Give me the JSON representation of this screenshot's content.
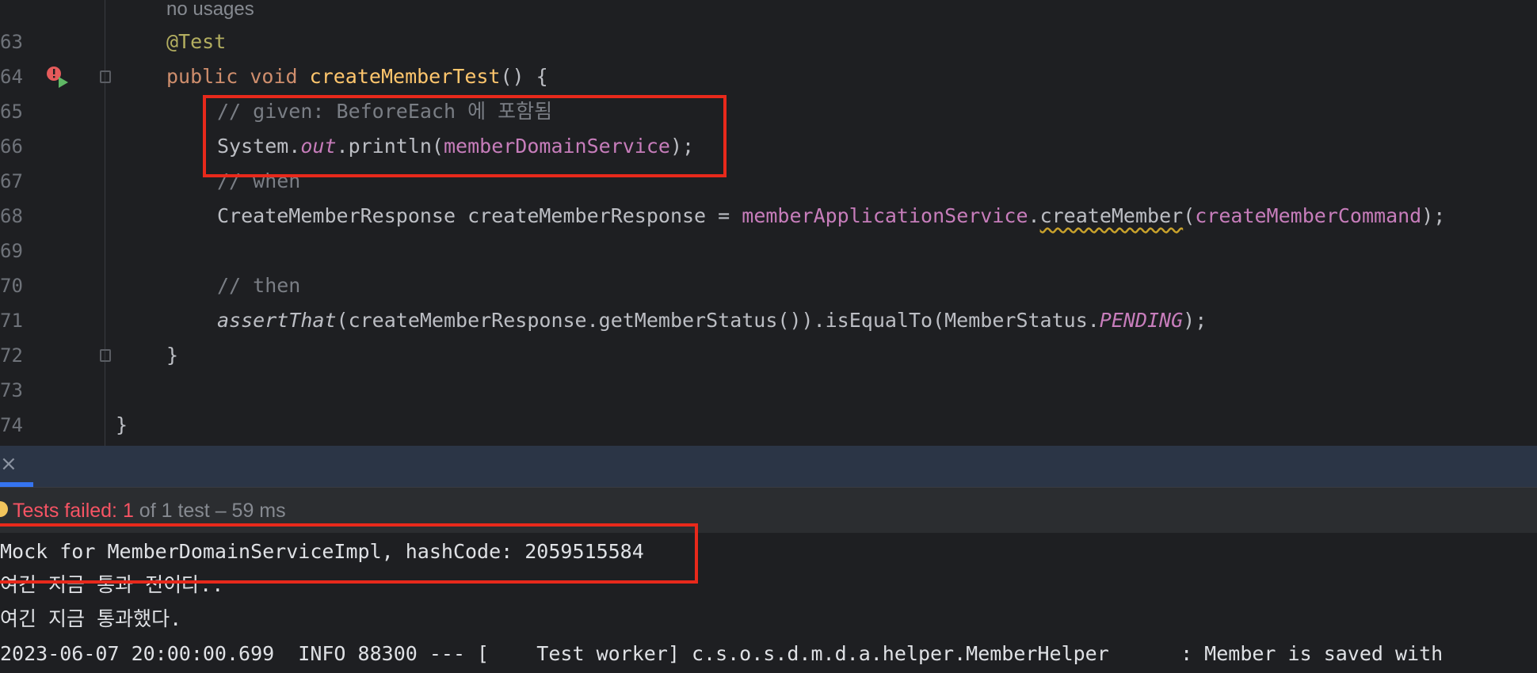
{
  "editor": {
    "usages_hint": "no usages",
    "lines": [
      {
        "num": "63",
        "annotation": "@Test"
      },
      {
        "num": "64",
        "kw_public": "public",
        "kw_void": "void",
        "method_name": "createMemberTest",
        "rest": "() {"
      },
      {
        "num": "65",
        "comment": "// given: BeforeEach 에 포함됨"
      },
      {
        "num": "66",
        "obj": "System.",
        "field": "out",
        "call": ".println(",
        "arg": "memberDomainService",
        "end": ");"
      },
      {
        "num": "67",
        "comment": "// when"
      },
      {
        "num": "68",
        "type": "CreateMemberResponse createMemberResponse = ",
        "service": "memberApplicationService",
        "dot": ".",
        "method": "createMember",
        "open": "(",
        "arg": "createMemberCommand",
        "end": ");"
      },
      {
        "num": "69"
      },
      {
        "num": "70",
        "comment": "// then"
      },
      {
        "num": "71",
        "assert": "assertThat",
        "middle": "(createMemberResponse.getMemberStatus()).isEqualTo(MemberStatus.",
        "constant": "PENDING",
        "end": ");"
      },
      {
        "num": "72",
        "brace": "}"
      },
      {
        "num": "73"
      },
      {
        "num": "74",
        "brace": "}"
      }
    ]
  },
  "icons": {
    "run_gutter": "run-test-icon",
    "fold_start": "fold-icon",
    "fold_end": "fold-end-icon",
    "close": "close-icon",
    "status": "test-failed-icon"
  },
  "run_panel": {
    "close_glyph": "×",
    "status_prefix": "Tests failed: 1",
    "status_suffix": " of 1 test – 59 ms"
  },
  "console": {
    "lines": [
      "Mock for MemberDomainServiceImpl, hashCode: 2059515584",
      "여긴 지금 통과 전이다..",
      "여긴 지금 통과했다.",
      "2023-06-07 20:00:00.699  INFO 88300 --- [    Test worker] c.s.o.s.d.m.d.a.helper.MemberHelper      : Member is saved with"
    ]
  },
  "colors": {
    "highlight_box": "#e8291b",
    "failed_text": "#f75464",
    "panel_header": "#2b3546"
  }
}
